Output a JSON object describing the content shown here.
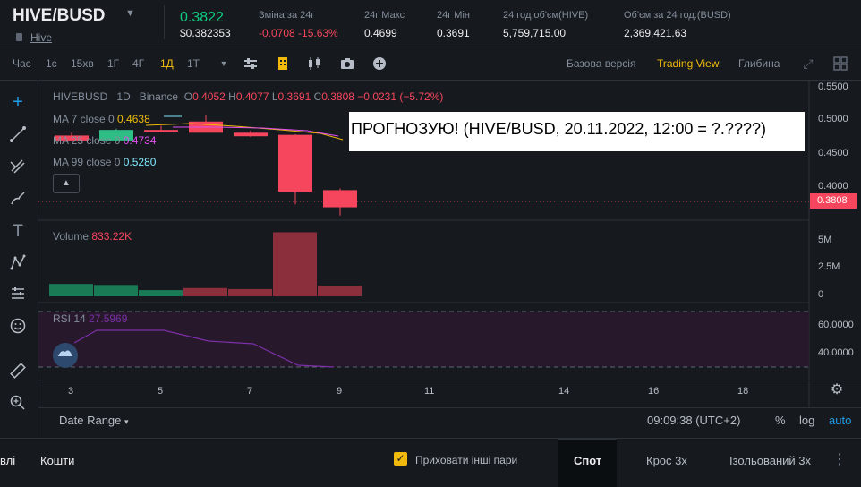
{
  "header": {
    "symbol": "HIVE/BUSD",
    "caret": "▼",
    "sub_link": "Hive",
    "last_price": "0.3822",
    "last_price_usd": "$0.382353",
    "stats": [
      {
        "label": "Зміна за 24г",
        "value": "-0.0708 -15.63%",
        "negative": true
      },
      {
        "label": "24г Макс",
        "value": "0.4699"
      },
      {
        "label": "24г Мін",
        "value": "0.3691"
      },
      {
        "label": "24 год об'єм(HIVE)",
        "value": "5,759,715.00"
      },
      {
        "label": "Об'єм за 24 год.(BUSD)",
        "value": "2,369,421.63"
      }
    ]
  },
  "toolbar": {
    "timeframes": [
      "Час",
      "1с",
      "15хв",
      "1Г",
      "4Г",
      "1Д",
      "1Т"
    ],
    "active_timeframe": "1Д",
    "views": [
      "Базова версія",
      "Trading View",
      "Глибина"
    ],
    "active_view": "Trading View"
  },
  "chart": {
    "ohlc_header": {
      "pair": "HIVEBUSD",
      "interval": "1D",
      "exchange": "Binance",
      "o": "0.4052",
      "h": "0.4077",
      "l": "0.3691",
      "c": "0.3808",
      "chg": "−0.0231 (−5.72%)"
    },
    "ma": [
      {
        "label": "MA 7 close 0",
        "value": "0.4638",
        "color": "#f0b90b"
      },
      {
        "label": "MA 25 close 0",
        "value": "0.4734",
        "color": "#e04ff0"
      },
      {
        "label": "MA 99 close 0",
        "value": "0.5280",
        "color": "#7de8ff"
      }
    ],
    "price_scale": [
      "0.5500",
      "0.5000",
      "0.4500",
      "0.4000"
    ],
    "current_price_tag": "0.3808",
    "volume_label": "Volume",
    "volume_value": "833.22K",
    "volume_scale": [
      "5M",
      "2.5M",
      "0"
    ],
    "rsi_label": "RSI 14",
    "rsi_value": "27.5969",
    "rsi_scale": [
      "60.0000",
      "40.0000"
    ],
    "x_labels": [
      "3",
      "5",
      "7",
      "9",
      "11",
      "14",
      "16",
      "18"
    ],
    "date_range": "Date Range",
    "clock": "09:09:38 (UTC+2)",
    "scale_opts": [
      "%",
      "log",
      "auto"
    ]
  },
  "overlay_text": "ПРОГНОЗУЮ! (HIVE/BUSD, 20.11.2022, 12:00 = ?.????)",
  "chart_data": {
    "type": "candlestick",
    "x": [
      "3",
      "4",
      "5",
      "6",
      "7",
      "8",
      "9"
    ],
    "candles": [
      {
        "o": 0.483,
        "h": 0.487,
        "l": 0.478,
        "c": 0.476
      },
      {
        "o": 0.476,
        "h": 0.493,
        "l": 0.474,
        "c": 0.491
      },
      {
        "o": 0.491,
        "h": 0.497,
        "l": 0.488,
        "c": 0.489
      },
      {
        "o": 0.503,
        "h": 0.513,
        "l": 0.488,
        "c": 0.487
      },
      {
        "o": 0.487,
        "h": 0.49,
        "l": 0.481,
        "c": 0.482
      },
      {
        "o": 0.484,
        "h": 0.485,
        "l": 0.385,
        "c": 0.403
      },
      {
        "o": 0.4052,
        "h": 0.4077,
        "l": 0.3691,
        "c": 0.3808
      }
    ],
    "volume": [
      1.2,
      1.1,
      0.6,
      0.8,
      0.7,
      6.2,
      1.0
    ],
    "volume_up": [
      true,
      true,
      true,
      false,
      false,
      false,
      false
    ],
    "ylim": [
      0.37,
      0.555
    ],
    "vol_lim": [
      0,
      6.5
    ]
  },
  "bottom": {
    "tabs_left": [
      "влі",
      "Кошти"
    ],
    "hide_pairs": "Приховати інші пари",
    "tabs_right": [
      "Спот",
      "Крос 3x",
      "Ізольований 3x"
    ],
    "active_right": "Спот"
  }
}
